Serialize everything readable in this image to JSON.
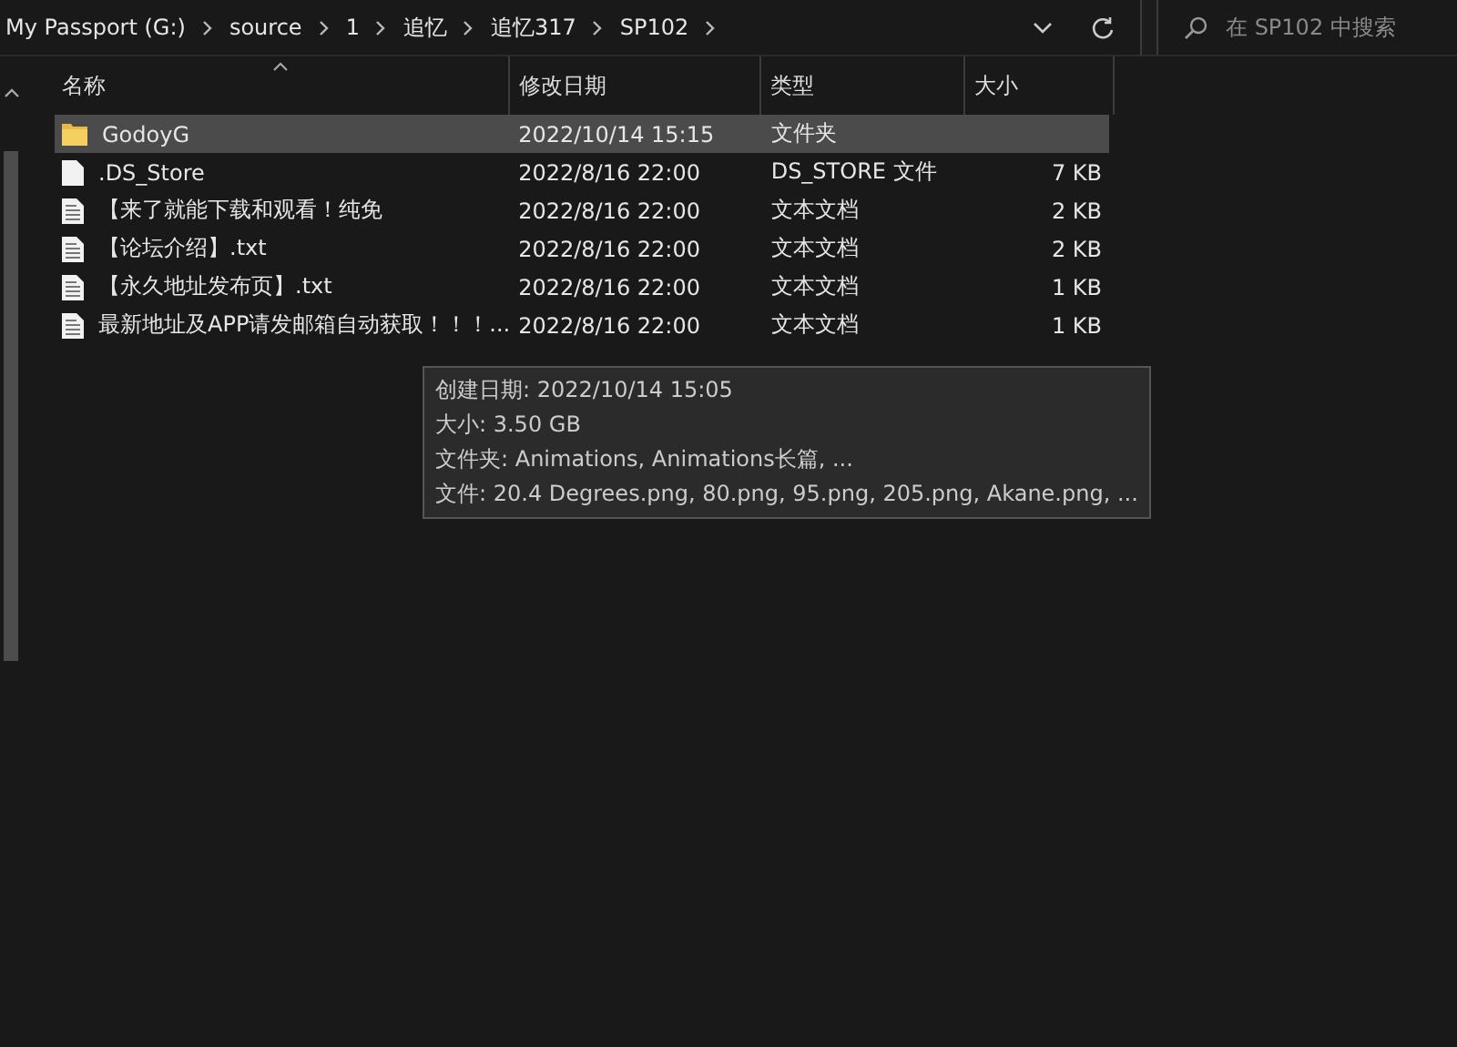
{
  "address_bar": {
    "crumbs": [
      "My Passport (G:)",
      "source",
      "1",
      "追忆",
      "追忆317",
      "SP102"
    ]
  },
  "search": {
    "placeholder": "在 SP102 中搜索"
  },
  "columns": [
    {
      "label": "名称",
      "sorted": true
    },
    {
      "label": "修改日期",
      "sorted": false
    },
    {
      "label": "类型",
      "sorted": false
    },
    {
      "label": "大小",
      "sorted": false
    }
  ],
  "rows": [
    {
      "kind": "folder",
      "name": "GodoyG",
      "date": "2022/10/14 15:15",
      "type": "文件夹",
      "size": "",
      "selected": true
    },
    {
      "kind": "file",
      "name": ".DS_Store",
      "date": "2022/8/16 22:00",
      "type": "DS_STORE 文件",
      "size": "7 KB",
      "selected": false
    },
    {
      "kind": "text",
      "name": "【来了就能下载和观看！纯免",
      "date": "2022/8/16 22:00",
      "type": "文本文档",
      "size": "2 KB",
      "selected": false
    },
    {
      "kind": "text",
      "name": "【论坛介绍】.txt",
      "date": "2022/8/16 22:00",
      "type": "文本文档",
      "size": "2 KB",
      "selected": false
    },
    {
      "kind": "text",
      "name": "【永久地址发布页】.txt",
      "date": "2022/8/16 22:00",
      "type": "文本文档",
      "size": "1 KB",
      "selected": false
    },
    {
      "kind": "text",
      "name": "最新地址及APP请发邮箱自动获取！！！...",
      "date": "2022/8/16 22:00",
      "type": "文本文档",
      "size": "1 KB",
      "selected": false
    }
  ],
  "tooltip": {
    "lines": [
      "创建日期: 2022/10/14 15:05",
      "大小: 3.50 GB",
      "文件夹: Animations, Animations长篇, ...",
      "文件: 20.4 Degrees.png, 80.png, 95.png, 205.png, Akane.png, ..."
    ]
  }
}
